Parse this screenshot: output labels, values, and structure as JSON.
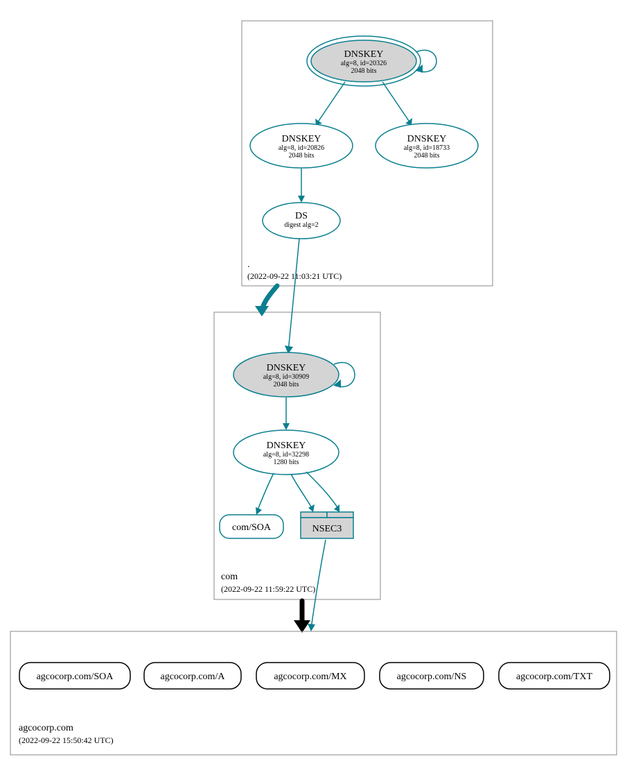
{
  "colors": {
    "teal": "#0a7f8f",
    "nodeGray": "#d4d4d4",
    "boxStroke": "#888888"
  },
  "zones": {
    "root": {
      "name": ".",
      "timestamp": "(2022-09-22 11:03:21 UTC)",
      "nodes": {
        "ksk": {
          "title": "DNSKEY",
          "l2": "alg=8, id=20326",
          "l3": "2048 bits"
        },
        "zsk1": {
          "title": "DNSKEY",
          "l2": "alg=8, id=20826",
          "l3": "2048 bits"
        },
        "zsk2": {
          "title": "DNSKEY",
          "l2": "alg=8, id=18733",
          "l3": "2048 bits"
        },
        "ds": {
          "title": "DS",
          "l2": "digest alg=2"
        }
      }
    },
    "com": {
      "name": "com",
      "timestamp": "(2022-09-22 11:59:22 UTC)",
      "nodes": {
        "ksk": {
          "title": "DNSKEY",
          "l2": "alg=8, id=30909",
          "l3": "2048 bits"
        },
        "zsk": {
          "title": "DNSKEY",
          "l2": "alg=8, id=32298",
          "l3": "1280 bits"
        },
        "soa": {
          "label": "com/SOA"
        },
        "nsec3": {
          "label": "NSEC3"
        }
      }
    },
    "target": {
      "name": "agcocorp.com",
      "timestamp": "(2022-09-22 15:50:42 UTC)",
      "records": [
        "agcocorp.com/SOA",
        "agcocorp.com/A",
        "agcocorp.com/MX",
        "agcocorp.com/NS",
        "agcocorp.com/TXT"
      ]
    }
  }
}
